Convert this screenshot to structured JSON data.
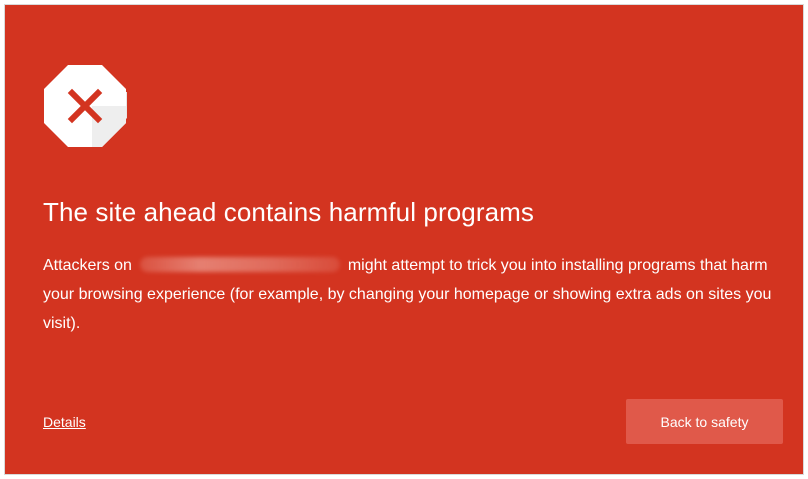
{
  "colors": {
    "background": "#d33420",
    "button": "#e0594a",
    "icon_fill": "#ffffff",
    "icon_shadow": "#e7e7e7",
    "icon_mark": "#d33420"
  },
  "warning_icon": {
    "icon": "octagon-x-icon"
  },
  "page": {
    "title": "The site ahead contains harmful programs",
    "message_before": "Attackers on",
    "message_after": "might attempt to trick you into installing programs that harm your browsing experience (for example, by changing your homepage or showing extra ads on sites you visit)."
  },
  "actions": {
    "details_label": "Details",
    "back_label": "Back to safety"
  }
}
